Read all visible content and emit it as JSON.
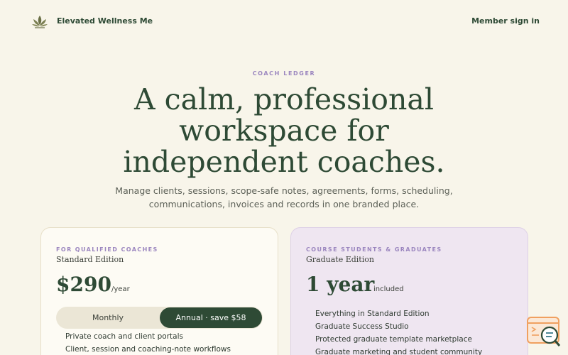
{
  "header": {
    "brand": "Elevated Wellness Me",
    "signin": "Member sign in"
  },
  "hero": {
    "eyebrow": "COACH LEDGER",
    "title_lines": [
      "A calm, professional",
      "workspace for",
      "independent coaches."
    ],
    "subtitle_lines": [
      "Manage clients, sessions, scope-safe notes, agreements, forms, scheduling,",
      "communications, invoices and records in one branded place."
    ]
  },
  "plans": [
    {
      "eyebrow": "FOR QUALIFIED COACHES",
      "edition": "Standard Edition",
      "price": "$290",
      "unit": "/year",
      "toggle": {
        "monthly": "Monthly",
        "annual": "Annual · save $58",
        "selected": "annual"
      },
      "features": [
        "Private coach and client portals",
        "Client, session and coaching-note workflows"
      ]
    },
    {
      "eyebrow": "COURSE STUDENTS & GRADUATES",
      "edition": "Graduate Edition",
      "duration": "1 year",
      "unit": "included",
      "features": [
        "Everything in Standard Edition",
        "Graduate Success Studio",
        "Protected graduate template marketplace",
        "Graduate marketing and student community"
      ]
    }
  ],
  "colors": {
    "background": "#f8f5ea",
    "primary": "#2e4a35",
    "accent": "#9b86bf",
    "graduate_card": "#efe6f1",
    "widget": "#f0a060"
  },
  "icons": {
    "logo": "lotus-icon",
    "widget": "search-chat-icon"
  }
}
